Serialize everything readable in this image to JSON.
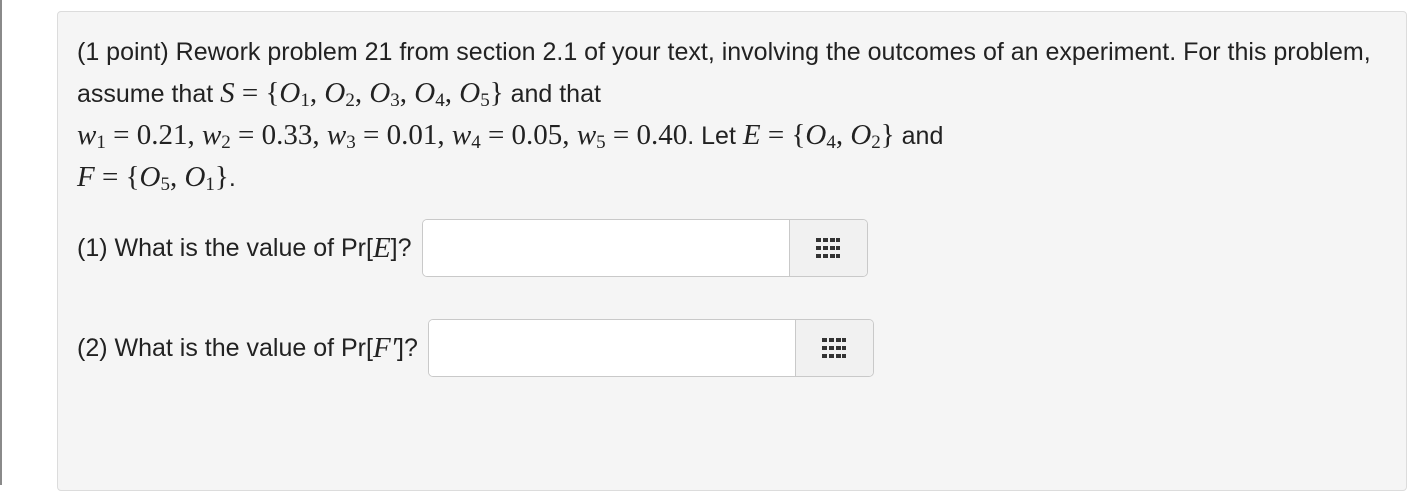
{
  "problem": {
    "intro": "(1 point) Rework problem 21 from section 2.1 of your text, involving the outcomes of an experiment. For this problem, assume that",
    "and_that": "and that",
    "let": ". Let",
    "and": "and",
    "period": "."
  },
  "questions": [
    {
      "label": "(1) What is the value of Pr[",
      "symbol": "E",
      "suffix": "]?",
      "value": "",
      "placeholder": ""
    },
    {
      "label": "(2) What is the value of Pr[",
      "symbol": "F′",
      "suffix": "]?",
      "value": "",
      "placeholder": ""
    }
  ],
  "icons": {
    "palette": "equation-palette-icon"
  },
  "colors": {
    "panel_bg": "#f5f5f5",
    "text": "#222222",
    "icon": "#333333"
  }
}
